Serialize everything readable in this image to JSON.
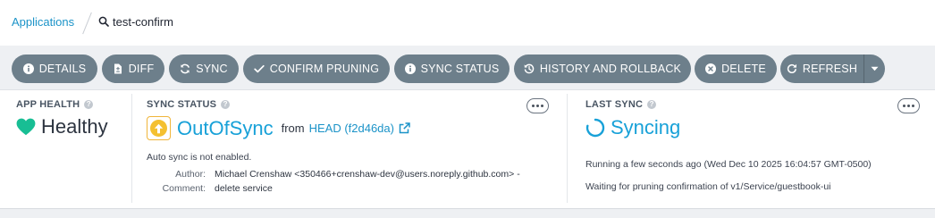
{
  "breadcrumb": {
    "parent": "Applications",
    "current": "test-confirm"
  },
  "toolbar": {
    "details": "DETAILS",
    "diff": "DIFF",
    "sync": "SYNC",
    "confirm_pruning": "CONFIRM PRUNING",
    "sync_status": "SYNC STATUS",
    "history": "HISTORY AND ROLLBACK",
    "delete": "DELETE",
    "refresh": "REFRESH"
  },
  "app_health": {
    "label": "APP HEALTH",
    "status": "Healthy"
  },
  "sync_status": {
    "label": "SYNC STATUS",
    "status": "OutOfSync",
    "from": "from",
    "revision": "HEAD (f2d46da)",
    "auto_sync": "Auto sync is not enabled.",
    "author_key": "Author:",
    "author_val": "Michael Crenshaw <350466+crenshaw-dev@users.noreply.github.com> -",
    "comment_key": "Comment:",
    "comment_val": "delete service"
  },
  "last_sync": {
    "label": "LAST SYNC",
    "status": "Syncing",
    "running": "Running a few seconds ago (Wed Dec 10 2025 16:04:57 GMT-0500)",
    "message": "Waiting for pruning confirmation of v1/Service/guestbook-ui"
  },
  "colors": {
    "accent": "#18a1d8",
    "healthy": "#18be94",
    "out_of_sync": "#f4c030",
    "button": "#6d7f8b"
  }
}
